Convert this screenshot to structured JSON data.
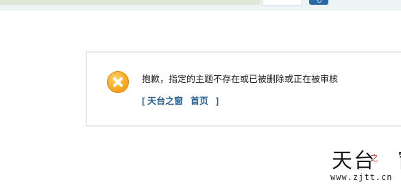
{
  "header": {
    "search_placeholder": ""
  },
  "notice": {
    "message": "抱歉，指定的主题不存在或已被删除或正在被审核",
    "bracket_open": "[",
    "bracket_close": "]",
    "links": [
      "天台之窗",
      "首页"
    ],
    "icon": "error-x-icon",
    "accent_color": "#f6a821",
    "link_color": "#2a5f90"
  },
  "watermark": {
    "logo_text": "天台之窗",
    "url": "www.zjtt.cn"
  }
}
